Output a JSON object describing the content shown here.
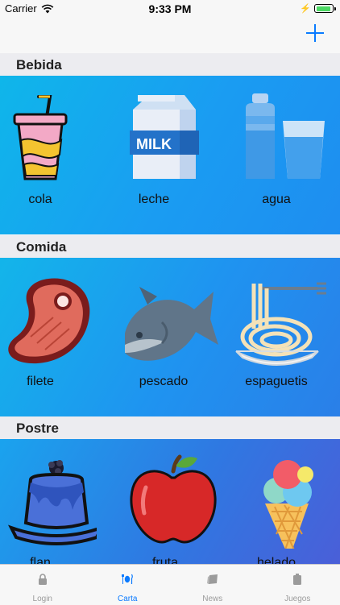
{
  "status_bar": {
    "carrier": "Carrier",
    "time": "9:33 PM"
  },
  "nav": {
    "add_icon": "plus-icon"
  },
  "sections": [
    {
      "title": "Bebida",
      "items": [
        {
          "label": "cola",
          "icon": "soda-cup-icon"
        },
        {
          "label": "leche",
          "icon": "milk-carton-icon"
        },
        {
          "label": "agua",
          "icon": "water-bottle-glass-icon"
        }
      ]
    },
    {
      "title": "Comida",
      "items": [
        {
          "label": "filete",
          "icon": "steak-icon"
        },
        {
          "label": "pescado",
          "icon": "fish-icon"
        },
        {
          "label": "espaguetis",
          "icon": "spaghetti-icon"
        }
      ]
    },
    {
      "title": "Postre",
      "items": [
        {
          "label": "flan",
          "icon": "flan-icon"
        },
        {
          "label": "fruta",
          "icon": "apple-icon"
        },
        {
          "label": "helado",
          "icon": "ice-cream-icon"
        }
      ]
    }
  ],
  "milk_text": "MILK",
  "tabs": [
    {
      "label": "Login",
      "icon": "lock-icon",
      "active": false
    },
    {
      "label": "Carta",
      "icon": "cutlery-icon",
      "active": true
    },
    {
      "label": "News",
      "icon": "newspaper-icon",
      "active": false
    },
    {
      "label": "Juegos",
      "icon": "game-icon",
      "active": false
    }
  ],
  "colors": {
    "accent": "#0a7aff",
    "tab_inactive": "#9b9b9b"
  }
}
